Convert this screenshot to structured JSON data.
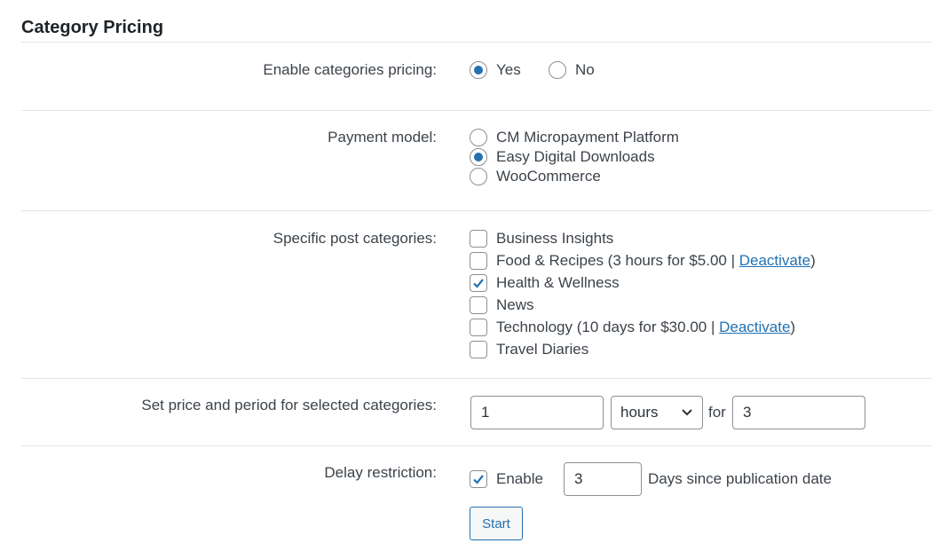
{
  "section": {
    "title": "Category Pricing"
  },
  "enable_pricing": {
    "label": "Enable categories pricing:",
    "options": [
      {
        "label": "Yes",
        "selected": true
      },
      {
        "label": "No",
        "selected": false
      }
    ]
  },
  "payment_model": {
    "label": "Payment model:",
    "options": [
      {
        "label": "CM Micropayment Platform",
        "selected": false
      },
      {
        "label": "Easy Digital Downloads",
        "selected": true
      },
      {
        "label": "WooCommerce",
        "selected": false
      }
    ]
  },
  "categories": {
    "label": "Specific post categories:",
    "items": [
      {
        "name": "Business Insights",
        "checked": false
      },
      {
        "name": "Food & Recipes",
        "checked": false,
        "detail_prefix": " (3 hours for $5.00 | ",
        "action": "Deactivate",
        "detail_suffix": ")"
      },
      {
        "name": "Health & Wellness",
        "checked": true
      },
      {
        "name": "News",
        "checked": false
      },
      {
        "name": "Technology",
        "checked": false,
        "detail_prefix": " (10 days for $30.00 | ",
        "action": "Deactivate",
        "detail_suffix": ")"
      },
      {
        "name": "Travel Diaries",
        "checked": false
      }
    ]
  },
  "price_period": {
    "label": "Set price and period for selected categories:",
    "price_value": "1",
    "period_unit": "hours",
    "for_text": "for",
    "period_value": "3"
  },
  "delay": {
    "label": "Delay restriction:",
    "enable_label": "Enable",
    "enabled": true,
    "days_value": "3",
    "suffix": "Days since publication date"
  },
  "start_button": {
    "label": "Start"
  },
  "colors": {
    "accent": "#2271b1",
    "text": "#3c434a",
    "border": "#8c8f94"
  }
}
